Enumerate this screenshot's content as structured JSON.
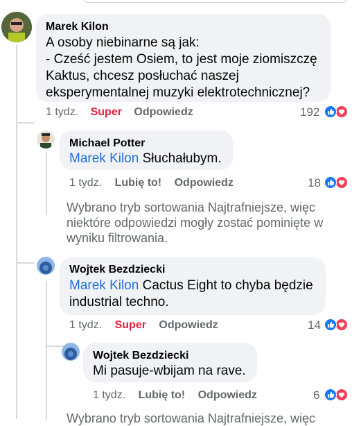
{
  "comments": [
    {
      "author": "Marek Kilon",
      "lines": [
        "A osoby niebinarne są jak:",
        "- Cześć jestem Osiem, to jest moje ziomiszczę",
        "Kaktus, chcesz posłuchać naszej",
        "eksperymentalnej muzyki elektrotechnicznej?"
      ],
      "time": "1 tydz.",
      "reaction_label": "Super",
      "reply_label": "Odpowiedz",
      "count": "192"
    },
    {
      "author": "Michael Potter",
      "mention": "Marek Kilon",
      "text": "Słuchałubym.",
      "time": "1 tydz.",
      "reaction_label": "Lubię to!",
      "reply_label": "Odpowiedz",
      "count": "18"
    },
    {
      "author": "Wojtek Bezdziecki",
      "mention": "Marek Kilon",
      "text": "Cactus Eight to chyba będzie",
      "text2": "industrial techno.",
      "time": "1 tydz.",
      "reaction_label": "Super",
      "reply_label": "Odpowiedz",
      "count": "14"
    },
    {
      "author": "Wojtek Bezdziecki",
      "text": "Mi pasuje-wbijam na rave.",
      "time": "1 tydz.",
      "reaction_label": "Lubię to!",
      "reply_label": "Odpowiedz",
      "count": "6"
    }
  ],
  "notice": {
    "lines": [
      "Wybrano tryb sortowania Najtrafniejsze, więc",
      "niektóre odpowiedzi mogły zostać pominięte w",
      "wyniku filtrowania."
    ]
  },
  "colors": {
    "super": "#e41e3f",
    "like": "#216fdb",
    "mention": "#216fdb"
  },
  "icons": [
    "like-icon",
    "love-icon"
  ]
}
